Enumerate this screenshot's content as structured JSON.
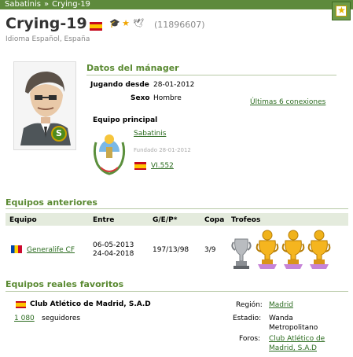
{
  "breadcrumb": {
    "parent": "Sabatinis",
    "separator": "»",
    "current": "Crying-19"
  },
  "header": {
    "name": "Crying-19",
    "id_text": "(11896607)",
    "subtitle": "Idioma Español, España",
    "icons": [
      "spain-flag",
      "graduation-cap-icon",
      "star-icon",
      "bird-icon"
    ]
  },
  "manager": {
    "section_title": "Datos del mánager",
    "playing_since_label": "Jugando desde",
    "playing_since_value": "28-01-2012",
    "sex_label": "Sexo",
    "sex_value": "Hombre",
    "connections_link": "Últimas 6 conexiones",
    "main_team_label": "Equipo principal",
    "team_name": "Sabatinis",
    "team_founded": "Fundado 28-01-2012",
    "league_link": "VI.552",
    "badge_letter": "S"
  },
  "previous_teams": {
    "section_title": "Equipos anteriores",
    "columns": [
      "Equipo",
      "Entre",
      "G/E/P*",
      "Copa",
      "Trofeos"
    ],
    "rows": [
      {
        "team": "Generalife CF",
        "date_from": "06-05-2013",
        "date_to": "24-04-2018",
        "gep": "197/13/98",
        "cup": "3/9",
        "trophies": [
          "silver-cup-icon",
          "gold-trophy-icon",
          "gold-trophy-icon",
          "gold-trophy-icon"
        ]
      }
    ]
  },
  "favorite_teams": {
    "section_title": "Equipos reales favoritos",
    "club": "Club Atlético de Madrid, S.A.D",
    "followers_count": "1 080",
    "followers_label": "seguidores",
    "region_label": "Región:",
    "region_value": "Madrid",
    "stadium_label": "Estadio:",
    "stadium_line1": "Wanda",
    "stadium_line2": "Metropolitano",
    "forums_label": "Foros:",
    "forums_line1": "Club Atlético de",
    "forums_line2": "Madrid, S.A.D"
  },
  "colors": {
    "brand_green": "#5e8a3c",
    "heading_green": "#5a8a32",
    "link_green": "#2b6b1f",
    "table_header_bg": "#e4ebdd"
  }
}
